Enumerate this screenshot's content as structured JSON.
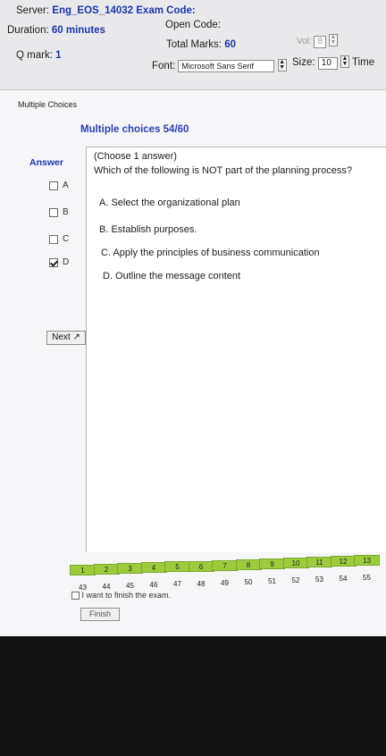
{
  "header": {
    "server_label": "Server:",
    "server_value": "Eng_EOS_14032",
    "exam_code_label": "Exam Code:",
    "duration_label": "Duration:",
    "duration_value": "60 minutes",
    "open_code_label": "Open Code:",
    "qmark_label": "Q mark:",
    "qmark_value": "1",
    "total_marks_label": "Total Marks:",
    "total_marks_value": "60",
    "vol_label": "Vol:",
    "vol_value": "8",
    "font_label": "Font:",
    "font_value": "Microsoft Sans Serif",
    "size_label": "Size:",
    "size_value": "10",
    "time_label": "Time"
  },
  "section_tab": "Multiple Choices",
  "question_header": "Multiple choices 54/60",
  "answer_label": "Answer",
  "answers": [
    {
      "label": "A",
      "checked": false
    },
    {
      "label": "B",
      "checked": false
    },
    {
      "label": "C",
      "checked": false
    },
    {
      "label": "D",
      "checked": true
    }
  ],
  "next_label": "Next",
  "question": {
    "instruction": "(Choose 1 answer)",
    "text": "Which of the following is NOT part of the planning process?",
    "options": [
      "A. Select the organizational plan",
      "B. Establish purposes.",
      "C. Apply the principles of business communication",
      "D. Outline the message content"
    ]
  },
  "nav_row1": [
    "1",
    "2",
    "3",
    "4",
    "5",
    "6",
    "7",
    "8",
    "9",
    "10",
    "11",
    "12",
    "13"
  ],
  "nav_row2": [
    "43",
    "44",
    "45",
    "46",
    "47",
    "48",
    "49",
    "50",
    "51",
    "52",
    "53",
    "54",
    "55"
  ],
  "finish_checkbox_label": "I want to finish the exam.",
  "finish_button": "Finish"
}
